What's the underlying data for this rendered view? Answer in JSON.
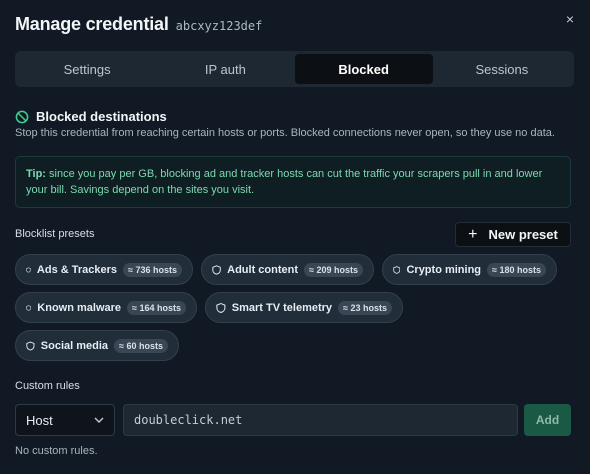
{
  "header": {
    "title": "Manage credential",
    "credential_id": "abcxyz123def",
    "close_icon": "×"
  },
  "tabs": [
    {
      "label": "Settings",
      "active": false
    },
    {
      "label": "IP auth",
      "active": false
    },
    {
      "label": "Blocked",
      "active": true
    },
    {
      "label": "Sessions",
      "active": false
    }
  ],
  "blocked": {
    "icon": "block-icon",
    "title": "Blocked destinations",
    "description": "Stop this credential from reaching certain hosts or ports. Blocked connections never open, so they use no data."
  },
  "tip": {
    "prefix": "Tip:",
    "text": " since you pay per GB, blocking ad and tracker hosts can cut the traffic your scrapers pull in and lower your bill. Savings depend on the sites you visit."
  },
  "presets": {
    "label": "Blocklist presets",
    "new_button": "New preset",
    "new_button_icon": "+",
    "items": [
      {
        "name": "Ads & Trackers",
        "count": "≈ 736 hosts"
      },
      {
        "name": "Adult content",
        "count": "≈ 209 hosts"
      },
      {
        "name": "Crypto mining",
        "count": "≈ 180 hosts"
      },
      {
        "name": "Known malware",
        "count": "≈ 164 hosts"
      },
      {
        "name": "Smart TV telemetry",
        "count": "≈ 23 hosts"
      },
      {
        "name": "Social media",
        "count": "≈ 60 hosts"
      }
    ]
  },
  "custom_rules": {
    "label": "Custom rules",
    "type_value": "Host",
    "input_placeholder": "doubleclick.net",
    "add_button": "Add",
    "empty_text": "No custom rules."
  },
  "colors": {
    "accent_green": "#1a5a44",
    "tip_text": "#7bd9b0",
    "active_tab": "#0c0f13"
  }
}
